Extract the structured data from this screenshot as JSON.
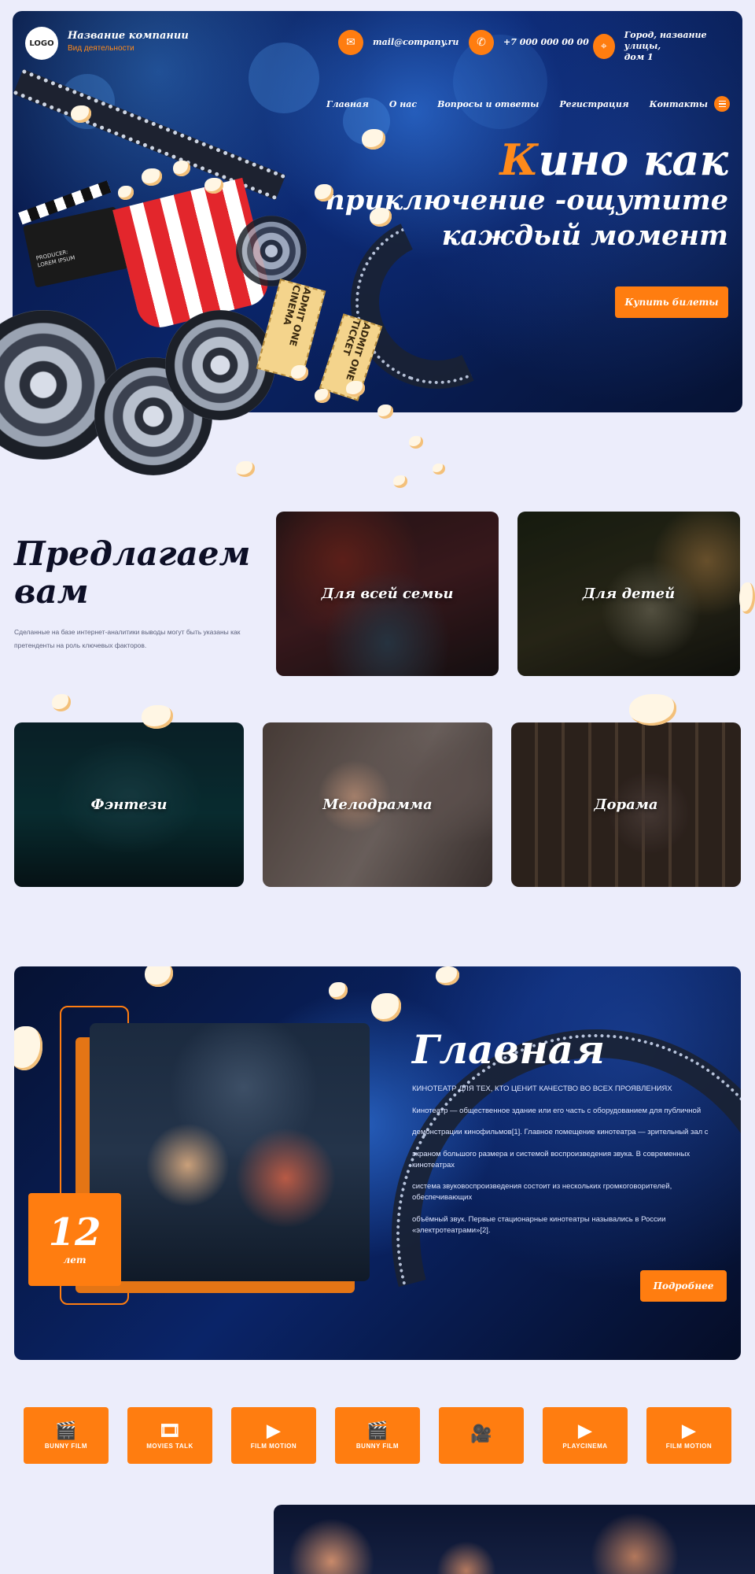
{
  "header": {
    "logo": "LOGO",
    "company_name": "Название компании",
    "company_sub": "Вид деятельности",
    "email": "mail@company.ru",
    "phone": "+7 000 000 00 00",
    "address_line1": "Город, название улицы,",
    "address_line2": "дом 1"
  },
  "nav": [
    "Главная",
    "О нас",
    "Вопросы и ответы",
    "Регистрация",
    "Контакты"
  ],
  "hero": {
    "accent_letter": "К",
    "title_l1_rest": "ино как",
    "title_l2": "приключение -ощутите",
    "title_l3": "каждый момент",
    "button": "Купить билеты",
    "clapper_l1": "PRODUCER:",
    "clapper_l2": "LOREM IPSUM",
    "ticket1": "ADMIT ONE CINEMA",
    "ticket2": "ADMIT ONE TICKET"
  },
  "offers": {
    "title_l1": "Предлагаем",
    "title_l2": "вам",
    "description": "Сделанные на базе интернет-аналитики выводы могут быть указаны как претенденты на роль ключевых факторов.",
    "cards": [
      "Для всей семьи",
      "Для детей",
      "Фэнтези",
      "Мелодрамма",
      "Дорама"
    ]
  },
  "about": {
    "title": "Главная",
    "caps_line": "Кинотеатр для тех, кто ценит качество во всех проявлениях",
    "p1": "Кинотеатр — общественное здание или его часть с оборудованием для публичной",
    "p2": "демонстрации кинофильмов[1]. Главное помещение кинотеатра — зрительный зал с",
    "p3": "экраном большого размера и системой воспроизведения звука. В современных кинотеатрах",
    "p4": "система звуковоспроизведения состоит из нескольких громкоговорителей, обеспечивающих",
    "p5": "объёмный звук. Первые стационарные кинотеатры назывались в России «электротеатрами»[2].",
    "years_num": "12",
    "years_unit": "лет",
    "button": "Подробнее"
  },
  "partners": [
    {
      "icon": "clapperboard-icon",
      "glyph": "🎬",
      "name": "BUNNY FILM"
    },
    {
      "icon": "film-frame-icon",
      "glyph": "🎞",
      "name": "MOVIES TALK"
    },
    {
      "icon": "play-strip-icon",
      "glyph": "▶",
      "name": "FILM MOTION"
    },
    {
      "icon": "clapperboard-icon",
      "glyph": "🎬",
      "name": "BUNNY FILM"
    },
    {
      "icon": "film-camera-icon",
      "glyph": "🎥",
      "name": ""
    },
    {
      "icon": "play-strip-icon",
      "glyph": "▶",
      "name": "PLAYCINEMA"
    },
    {
      "icon": "play-strip-icon",
      "glyph": "▶",
      "name": "FILM MOTION"
    }
  ],
  "colors": {
    "accent": "#ff7d10",
    "page_bg": "#ecedfb",
    "navy": "#0a2468"
  }
}
